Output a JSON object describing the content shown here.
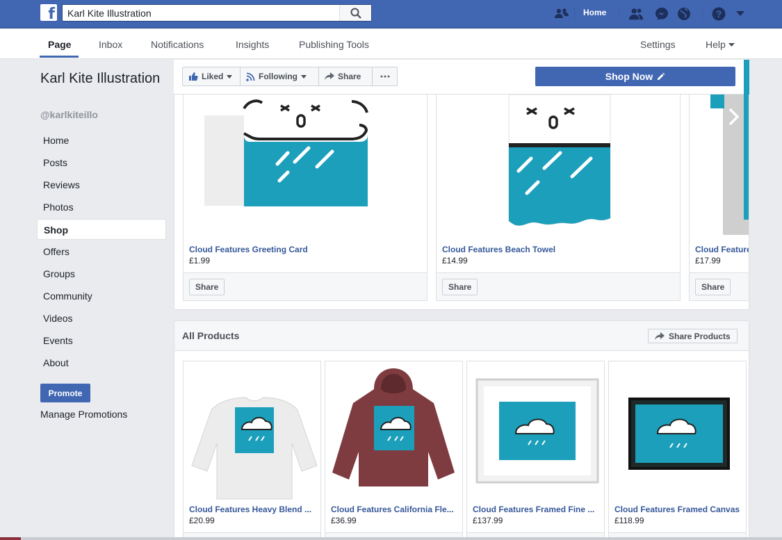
{
  "topbar": {
    "search_value": "Karl Kite Illustration",
    "home_label": "Home"
  },
  "tabs": [
    "Page",
    "Inbox",
    "Notifications",
    "Insights",
    "Publishing Tools"
  ],
  "tabs_right": [
    "Settings",
    "Help"
  ],
  "sidebar": {
    "page_name": "Karl Kite Illustration",
    "handle": "@karlkiteillo",
    "items": [
      "Home",
      "Posts",
      "Reviews",
      "Photos",
      "Shop",
      "Offers",
      "Groups",
      "Community",
      "Videos",
      "Events",
      "About"
    ],
    "active_item": "Shop",
    "promote_label": "Promote",
    "manage_label": "Manage Promotions"
  },
  "actions": {
    "liked": "Liked",
    "following": "Following",
    "share": "Share",
    "shop_now": "Shop Now"
  },
  "featured": [
    {
      "name": "Cloud Features Greeting Card",
      "price": "£1.99",
      "share": "Share"
    },
    {
      "name": "Cloud Features Beach Towel",
      "price": "£14.99",
      "share": "Share"
    },
    {
      "name": "Cloud Feature",
      "price": "£17.99",
      "share": "Share"
    }
  ],
  "all_products": {
    "title": "All Products",
    "share_label": "Share Products",
    "items": [
      {
        "name": "Cloud Features Heavy Blend ...",
        "price": "£20.99"
      },
      {
        "name": "Cloud Features California Fle...",
        "price": "£36.99"
      },
      {
        "name": "Cloud Features Framed Fine ...",
        "price": "£137.99"
      },
      {
        "name": "Cloud Features Framed Canvas",
        "price": "£118.99"
      }
    ]
  },
  "colors": {
    "brand": "#4267b2",
    "teal": "#1c9fbb",
    "link": "#365899"
  }
}
